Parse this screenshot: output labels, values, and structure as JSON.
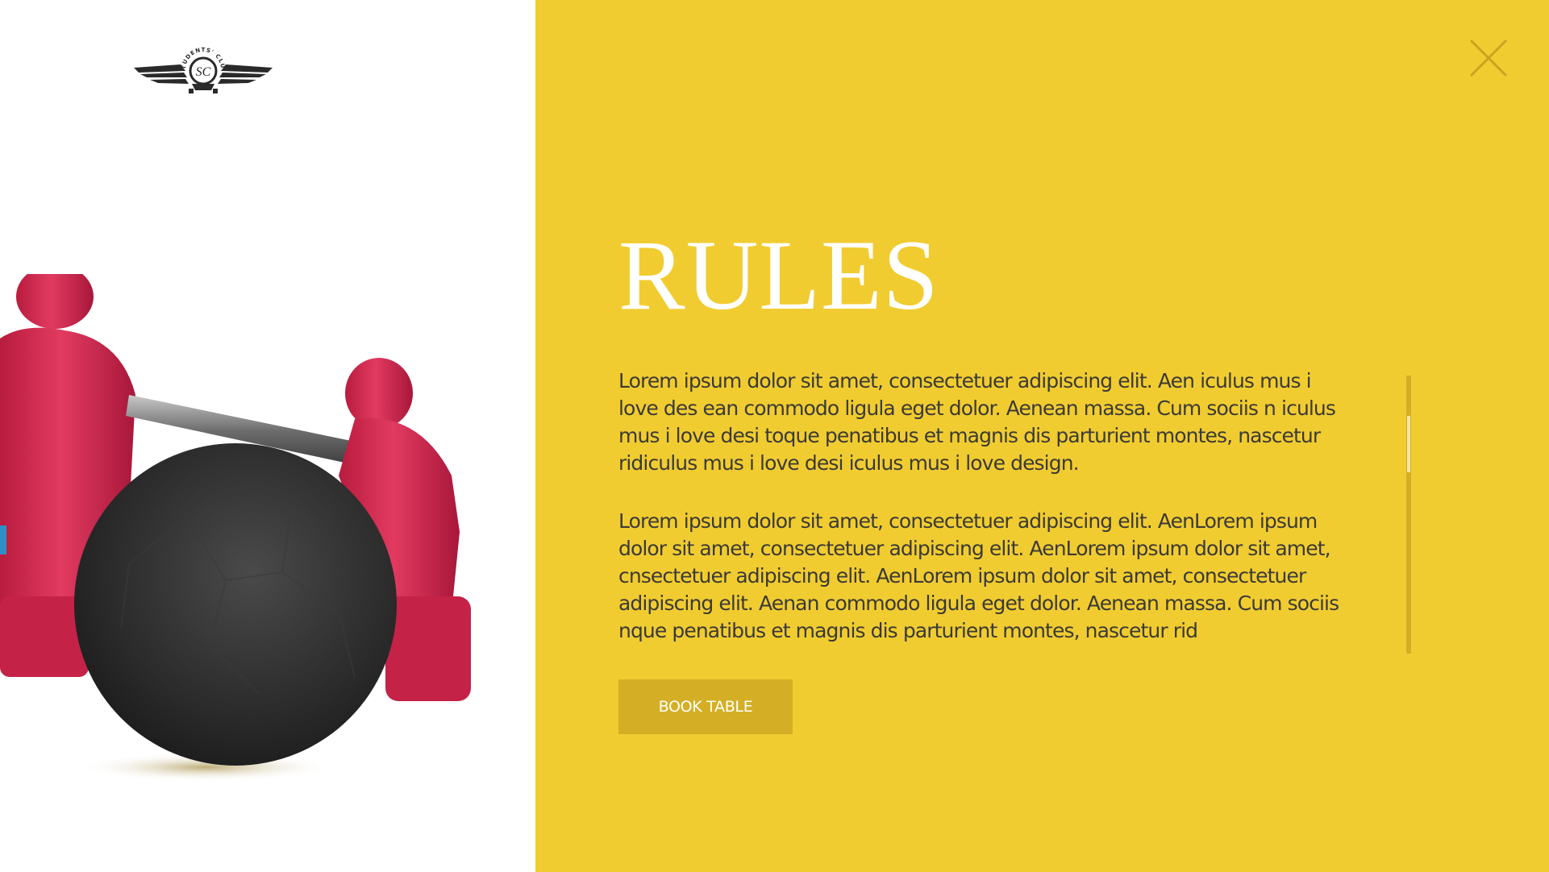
{
  "logo": {
    "arc_text": "STUDENTS' CLUB",
    "monogram": "SC"
  },
  "modal": {
    "title": "RULES",
    "paragraphs": [
      "Lorem ipsum dolor sit amet, consectetuer adipiscing elit. Aen iculus mus i love des ean commodo ligula eget dolor. Aenean massa. Cum sociis n iculus mus i love desi toque penatibus et magnis dis parturient montes, nascetur ridiculus mus i love desi iculus mus i love design.",
      "Lorem ipsum dolor sit amet, consectetuer adipiscing elit. AenLorem ipsum dolor sit amet, consectetuer adipiscing elit. AenLorem ipsum dolor sit amet, cnsectetuer adipiscing elit. AenLorem ipsum dolor sit amet, consectetuer adipiscing elit. Aenan commodo ligula eget dolor. Aenean massa. Cum sociis nque penatibus et magnis dis parturient montes, nascetur rid"
    ],
    "book_button_label": "BOOK TABLE",
    "close_icon": "close-icon"
  },
  "colors": {
    "accent_yellow": "#f1cc31",
    "button_gold": "#d4af25",
    "text_dark": "#3b3a34",
    "foosball_player_red": "#d6294f",
    "ball_black": "#2b2b2b"
  }
}
